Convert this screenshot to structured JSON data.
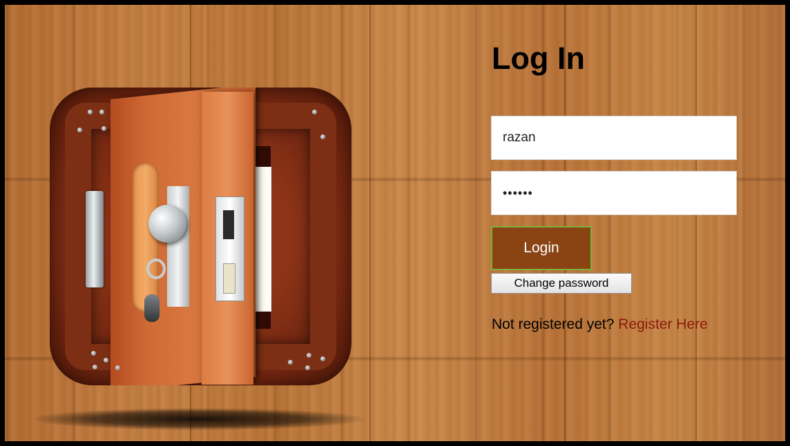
{
  "login": {
    "title": "Log In",
    "username_value": "razan",
    "password_value": "••••••",
    "login_button": "Login",
    "change_password_button": "Change password",
    "register_prompt": "Not registered yet?",
    "register_link": "Register Here"
  },
  "colors": {
    "login_button_bg": "#8a4313",
    "login_button_border": "#7ab23c",
    "register_link": "#8c1a0e",
    "wood_background": "#c17d42"
  },
  "icons": {
    "app_logo": "wooden-door-lock-icon"
  }
}
